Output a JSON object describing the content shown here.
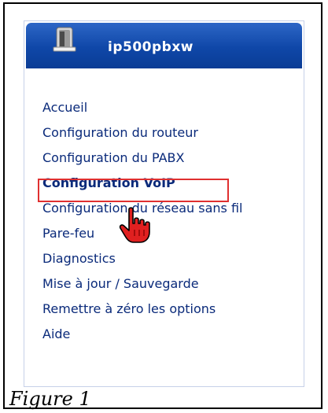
{
  "header": {
    "title": "ip500pbxw",
    "icon": "router-device-icon",
    "gradient_top": "#2d66c6",
    "gradient_bottom": "#0a3c95"
  },
  "menu": {
    "items": [
      {
        "label": "Accueil"
      },
      {
        "label": "Configuration du routeur"
      },
      {
        "label": "Configuration du PABX"
      },
      {
        "label": "Configuration VoIP",
        "active": true
      },
      {
        "label": "Configuration du réseau sans fil",
        "partially_obscured_by_cursor": true
      },
      {
        "label": "Pare-feu"
      },
      {
        "label": "Diagnostics"
      },
      {
        "label": "Mise à jour / Sauvegarde"
      },
      {
        "label": "Remettre à zéro les options"
      },
      {
        "label": "Aide"
      }
    ],
    "link_color": "#0a2a7a",
    "highlight_color": "#e03030"
  },
  "cursor": {
    "icon": "hand-pointer-cursor-icon",
    "color": "#e02020"
  },
  "caption": "Figure 1"
}
